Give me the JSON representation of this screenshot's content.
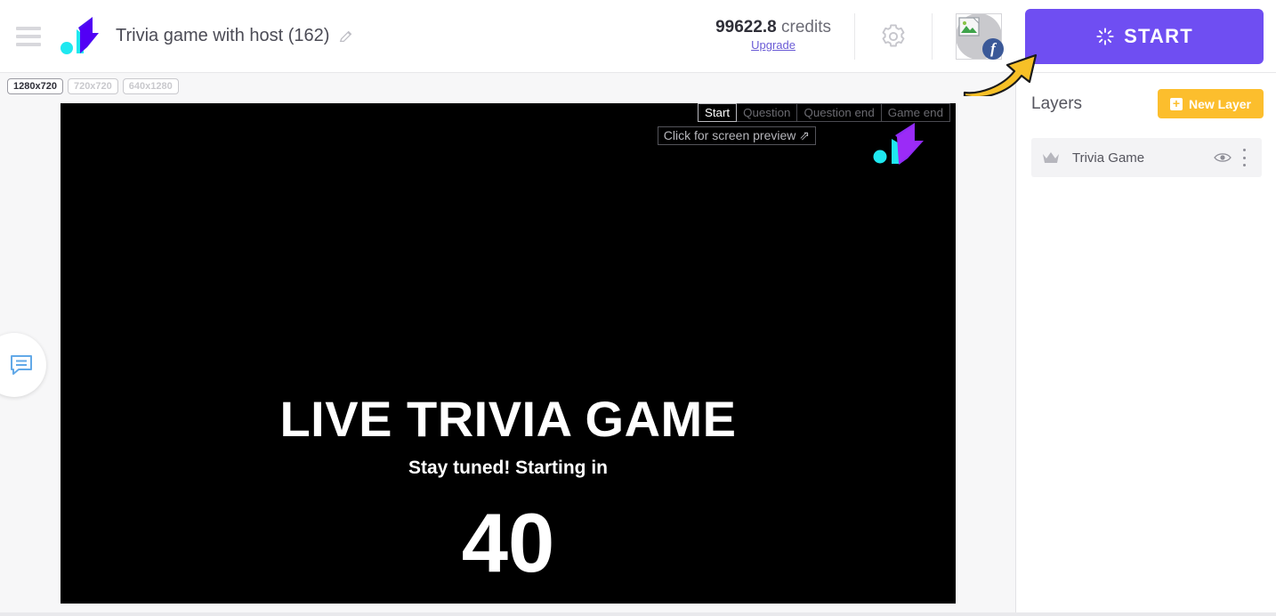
{
  "topbar": {
    "menu_icon": "hamburger-menu-icon",
    "logo_icon": "brand-logo-icon",
    "project_title": "Trivia game with host (162)",
    "edit_icon": "pencil-edit-icon",
    "credits_value": "99622.8",
    "credits_unit": "credits",
    "upgrade_label": "Upgrade",
    "settings_icon": "gear-icon",
    "avatar_icon": "avatar",
    "avatar_broken_icon": "broken-image-icon",
    "social_badge": "f",
    "social_badge_name": "facebook-badge-icon",
    "start_label": "START",
    "start_icon": "spinner-sparkle-icon",
    "start_color": "#6f4ef2"
  },
  "annotation": {
    "arrow_icon": "curved-arrow-annotation",
    "arrow_color": "#f5bf2a"
  },
  "editor": {
    "resolutions": [
      {
        "label": "1280x720",
        "active": true
      },
      {
        "label": "720x720",
        "active": false
      },
      {
        "label": "640x1280",
        "active": false
      }
    ],
    "scene_tabs": [
      {
        "label": "Start",
        "active": true
      },
      {
        "label": "Question",
        "active": false
      },
      {
        "label": "Question end",
        "active": false
      },
      {
        "label": "Game end",
        "active": false
      }
    ],
    "preview_hint": "Click for screen preview ⇗",
    "canvas_logo_icon": "brand-logo-watermark-icon",
    "canvas": {
      "headline": "LIVE TRIVIA GAME",
      "subline": "Stay tuned! Starting in",
      "countdown": "40"
    },
    "chat_icon": "chat-bubble-icon"
  },
  "sidebar": {
    "title": "Layers",
    "new_layer_label": "New Layer",
    "new_layer_icon": "plus-icon",
    "new_layer_color": "#fcbe2d",
    "layers": [
      {
        "name": "Trivia Game",
        "crown_icon": "crown-icon",
        "visibility_icon": "eye-icon",
        "menu_icon": "kebab-menu-icon"
      }
    ]
  }
}
